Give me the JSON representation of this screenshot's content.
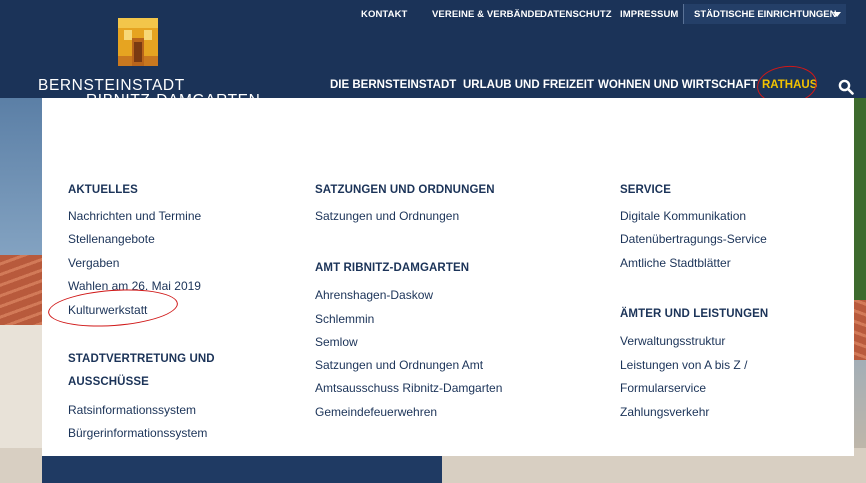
{
  "utility_bar": {
    "links": [
      "KONTAKT",
      "VEREINE & VERBÄNDE",
      "DATENSCHUTZ",
      "IMPRESSUM"
    ],
    "select_label": "STÄDTISCHE EINRICHTUNGEN"
  },
  "logo": {
    "line1": "BERNSTEINSTADT",
    "line2": "RIBNITZ-DAMGARTEN"
  },
  "nav": {
    "items": [
      "DIE BERNSTEINSTADT",
      "URLAUB UND FREIZEIT",
      "WOHNEN UND WIRTSCHAFT",
      "RATHAUS"
    ],
    "active_color": "#f3c300"
  },
  "menu": {
    "col1": {
      "heading1": "AKTUELLES",
      "links1": [
        "Nachrichten und Termine",
        "Stellenangebote",
        "Vergaben",
        "Wahlen am 26. Mai 2019",
        "Kulturwerkstatt"
      ],
      "heading2_line1": "STADTVERTRETUNG UND",
      "heading2_line2": "AUSSCHÜSSE",
      "links2": [
        "Ratsinformationssystem",
        "Bürgerinformationssystem"
      ]
    },
    "col2": {
      "heading1": "SATZUNGEN UND ORDNUNGEN",
      "links1": [
        "Satzungen und Ordnungen"
      ],
      "heading2": "AMT RIBNITZ-DAMGARTEN",
      "links2": [
        "Ahrenshagen-Daskow",
        "Schlemmin",
        "Semlow",
        "Satzungen und Ordnungen Amt",
        "Amtsausschuss Ribnitz-Damgarten",
        "Gemeindefeuerwehren"
      ]
    },
    "col3": {
      "heading1": "SERVICE",
      "links1": [
        "Digitale Kommunikation",
        "Datenübertragungs-Service",
        "Amtliche Stadtblätter"
      ],
      "heading2": "ÄMTER UND LEISTUNGEN",
      "links2": [
        "Verwaltungsstruktur",
        "Leistungen von A bis Z /",
        "Formularservice",
        "Zahlungsverkehr"
      ]
    }
  },
  "colors": {
    "navy": "#1b3358",
    "highlight_ring": "#d01818"
  },
  "icons": {
    "search": "search-icon",
    "dropdown": "caret-down-icon"
  }
}
